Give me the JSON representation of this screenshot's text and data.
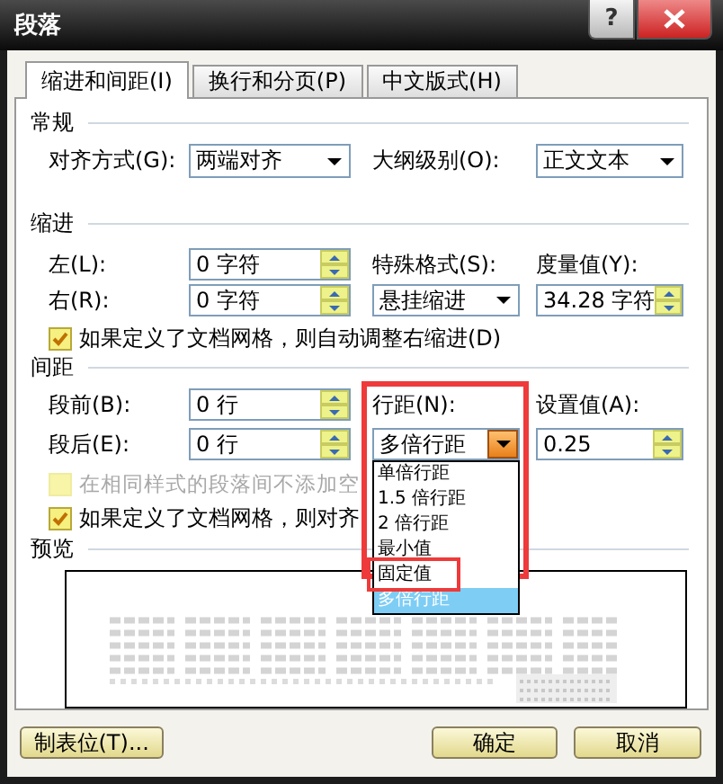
{
  "window": {
    "title": "段落",
    "help": "?"
  },
  "tabs": [
    {
      "label": "缩进和间距(I)",
      "selected": true
    },
    {
      "label": "换行和分页(P)",
      "selected": false
    },
    {
      "label": "中文版式(H)",
      "selected": false
    }
  ],
  "general": {
    "title": "常规",
    "alignment": {
      "label": "对齐方式(G):",
      "value": "两端对齐"
    },
    "outline": {
      "label": "大纲级别(O):",
      "value": "正文文本"
    }
  },
  "indent": {
    "title": "缩进",
    "left": {
      "label": "左(L):",
      "value": "0 字符"
    },
    "right": {
      "label": "右(R):",
      "value": "0 字符"
    },
    "special": {
      "label": "特殊格式(S):",
      "value": "悬挂缩进"
    },
    "by": {
      "label": "度量值(Y):",
      "value": "34.28 字符"
    },
    "checkbox": {
      "label": "如果定义了文档网格，则自动调整右缩进(D)",
      "checked": true,
      "disabled": false
    }
  },
  "spacing": {
    "title": "间距",
    "before": {
      "label": "段前(B):",
      "value": "0 行"
    },
    "after": {
      "label": "段后(E):",
      "value": "0 行"
    },
    "line_spacing": {
      "label": "行距(N):",
      "value": "多倍行距",
      "expanded": true,
      "options": [
        {
          "label": "单倍行距",
          "selected": false
        },
        {
          "label": "1.5 倍行距",
          "selected": false
        },
        {
          "label": "2 倍行距",
          "selected": false
        },
        {
          "label": "最小值",
          "selected": false
        },
        {
          "label": "固定值",
          "selected": false
        },
        {
          "label": "多倍行距",
          "selected": true
        }
      ]
    },
    "at": {
      "label": "设置值(A):",
      "value": "0.25"
    },
    "checkboxes": [
      {
        "label": "在相同样式的段落间不添加空",
        "checked": false,
        "disabled": true
      },
      {
        "label": "如果定义了文档网格，则对齐",
        "checked": true,
        "disabled": false
      }
    ]
  },
  "preview": {
    "title": "预览"
  },
  "buttons": [
    {
      "label": "制表位(T)..."
    },
    {
      "label": "确定"
    },
    {
      "label": "取消"
    }
  ]
}
